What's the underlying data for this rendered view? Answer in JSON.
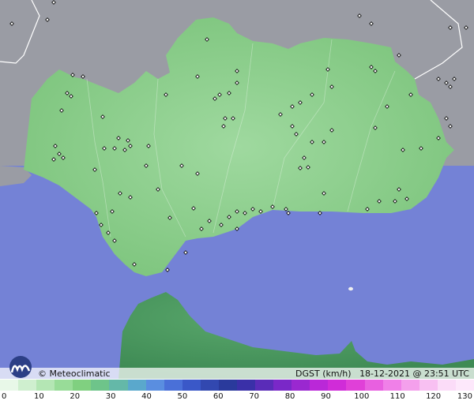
{
  "map": {
    "colors": {
      "land_outside": "#9a9ca4",
      "sea": "#7482d6",
      "region": "#86cf86",
      "africa": "#4e9a62",
      "border": "#ffffff",
      "station": "#000000"
    }
  },
  "info": {
    "brand": "© Meteoclimatic",
    "variable": "DGST (km/h)",
    "timestamp": "18-12-2021 @ 23:51 UTC"
  },
  "legend": {
    "ticks": [
      "0",
      "10",
      "20",
      "30",
      "40",
      "50",
      "60",
      "70",
      "80",
      "90",
      "100",
      "110",
      "120",
      "130"
    ],
    "colors": [
      "#e8f8e8",
      "#cfefcf",
      "#b4e6b4",
      "#98dc98",
      "#80d080",
      "#6ec48a",
      "#64b8a8",
      "#5aa8cc",
      "#5a8ee0",
      "#4a70d8",
      "#3a58c8",
      "#3248b0",
      "#2a3a9c",
      "#3a30a8",
      "#5a2cb8",
      "#7a28c8",
      "#9a28d0",
      "#ba28d8",
      "#d02cd8",
      "#e040d8",
      "#e860e0",
      "#f080e8",
      "#f4a0ec",
      "#f8c0f2",
      "#fbdcf8",
      "#fde8fb"
    ]
  }
}
